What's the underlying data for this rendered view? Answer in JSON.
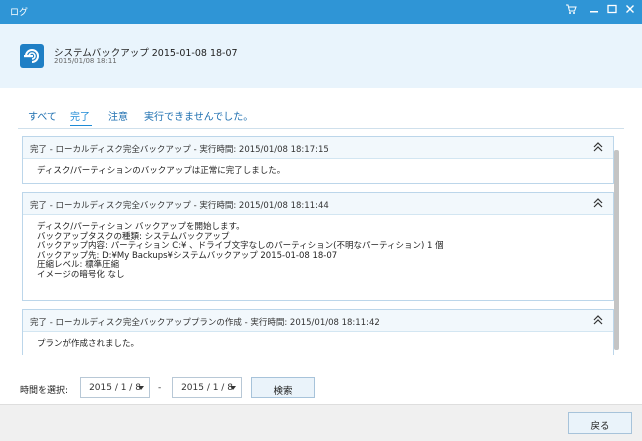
{
  "window": {
    "title": "ログ",
    "controls": [
      "cart-icon",
      "minimize-icon",
      "maximize-icon",
      "close-icon"
    ]
  },
  "header": {
    "task_name": "システムバックアップ 2015-01-08 18-07",
    "task_date": "2015/01/08 18:11"
  },
  "tabs": [
    {
      "label": "すべて",
      "active": false
    },
    {
      "label": "完了",
      "active": true
    },
    {
      "label": "注意",
      "active": false
    },
    {
      "label": "実行できませんでした。",
      "active": false
    }
  ],
  "log_entries": [
    {
      "title": "完了 - ローカルディスク完全バックアップ - 実行時間: 2015/01/08 18:17:15",
      "lines": [
        "ディスク/パーティションのバックアップは正常に完了しました。"
      ]
    },
    {
      "title": "完了 - ローカルディスク完全バックアップ - 実行時間: 2015/01/08 18:11:44",
      "lines": [
        "ディスク/パーティション バックアップを開始します。",
        "バックアップタスクの種類: システムバックアップ",
        "バックアップ内容: パーティション C:¥ 、ドライブ文字なしのパーティション(不明なパーティション) 1 個",
        "バックアップ先: D:¥My Backups¥システムバックアップ 2015-01-08 18-07",
        "圧縮レベル: 標準圧縮",
        "イメージの暗号化 なし"
      ]
    },
    {
      "title": "完了 - ローカルディスク完全バックアッププランの作成 - 実行時間: 2015/01/08 18:11:42",
      "lines": [
        "プランが作成されました。"
      ]
    }
  ],
  "filter": {
    "label": "時間を選択:",
    "from": "2015 / 1 / 8",
    "separator": "-",
    "to": "2015 / 1 / 8",
    "search_label": "検索"
  },
  "footer": {
    "back_label": "戻る"
  },
  "colors": {
    "titlebar": "#2f95d6",
    "accent": "#1e8bd6",
    "header_bg": "#e9f4fc"
  }
}
